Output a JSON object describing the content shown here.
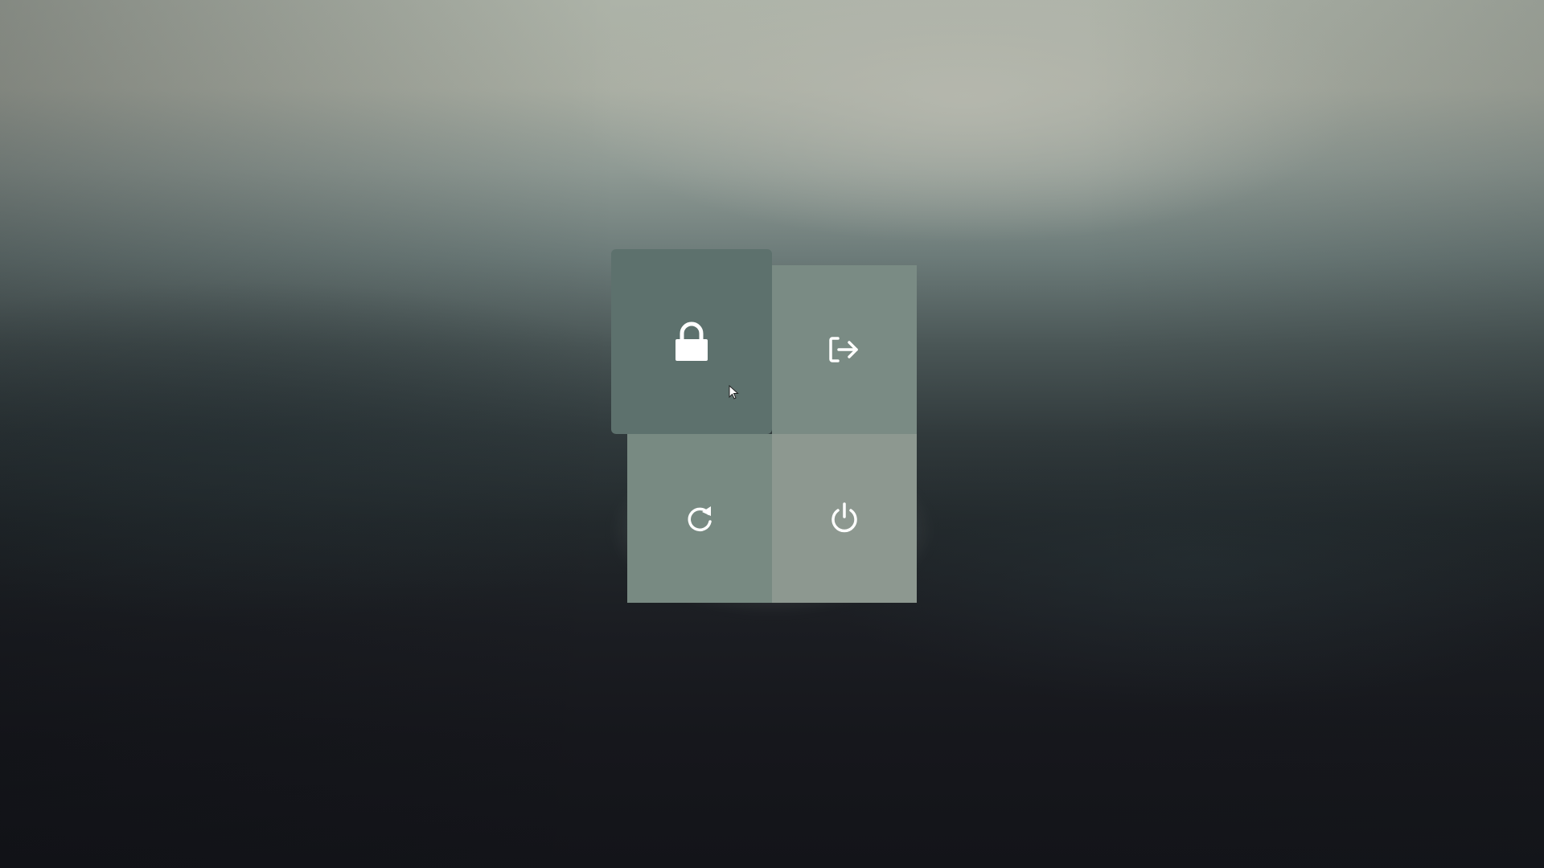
{
  "screen": {
    "description_free": true
  },
  "power_menu": {
    "options": [
      {
        "id": "lock",
        "icon": "lock-icon",
        "active": true,
        "color": "#5d716d"
      },
      {
        "id": "logout",
        "icon": "logout-icon",
        "active": false,
        "color": "#7a8b84"
      },
      {
        "id": "reboot",
        "icon": "reboot-icon",
        "active": false,
        "color": "#788a82"
      },
      {
        "id": "shutdown",
        "icon": "power-icon",
        "active": false,
        "color": "#8d9890"
      }
    ],
    "icon_color": "#ffffff"
  }
}
